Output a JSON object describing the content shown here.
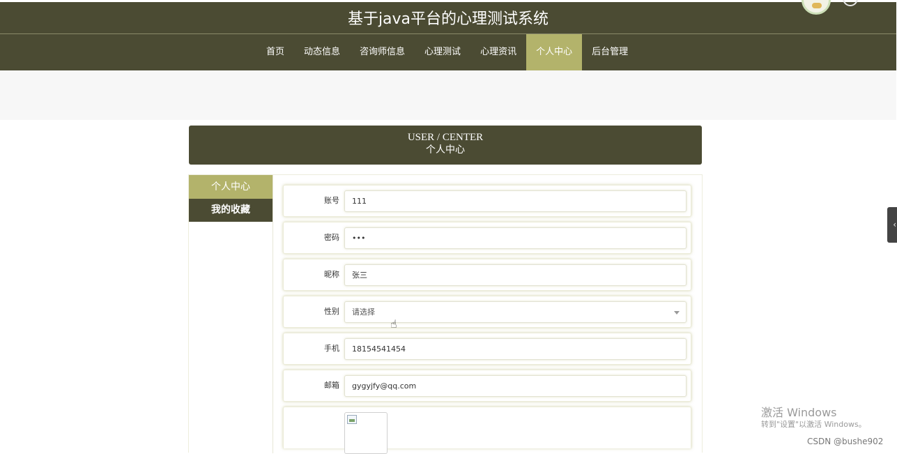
{
  "header": {
    "site_title": "基于java平台的心理测试系统"
  },
  "nav": {
    "items": [
      {
        "label": "首页"
      },
      {
        "label": "动态信息"
      },
      {
        "label": "咨询师信息"
      },
      {
        "label": "心理测试"
      },
      {
        "label": "心理资讯"
      },
      {
        "label": "个人中心",
        "active": true
      },
      {
        "label": "后台管理"
      }
    ],
    "active_color": "#b3b36b",
    "bar_color": "#4b4b33"
  },
  "center_header": {
    "en_title": "USER / CENTER",
    "cn_title": "个人中心"
  },
  "sidemenu": {
    "items": [
      {
        "label": "个人中心",
        "active": true
      },
      {
        "label": "我的收藏",
        "active": false
      }
    ]
  },
  "form": {
    "account": {
      "label": "账号",
      "value": "111"
    },
    "password": {
      "label": "密码",
      "value": "•••"
    },
    "nickname": {
      "label": "昵称",
      "value": "张三"
    },
    "gender": {
      "label": "性别",
      "value": "请选择"
    },
    "phone": {
      "label": "手机",
      "value": "18154541454"
    },
    "email": {
      "label": "邮箱",
      "value": "gygyjfy@qq.com"
    }
  },
  "icons": {
    "side_tab": "chevron-left-icon",
    "cursor": "hand-pointer-icon",
    "avatar_image": "broken-image-icon"
  },
  "overlay": {
    "windows_activate_line1": "激活 Windows",
    "windows_activate_line2": "转到\"设置\"以激活 Windows。",
    "csdn_watermark": "CSDN @bushe902"
  }
}
